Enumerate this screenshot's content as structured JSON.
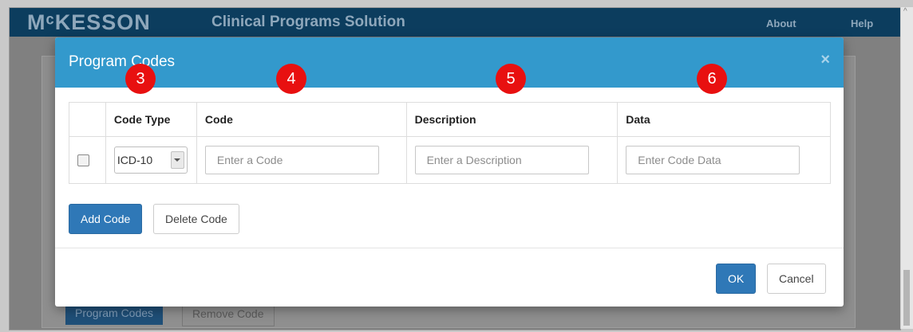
{
  "app": {
    "logo": "MᶜKESSON",
    "title": "Clinical Programs Solution",
    "nav": {
      "about": "About",
      "help": "Help"
    }
  },
  "background": {
    "program_codes_button": "Program Codes",
    "remove_code_button": "Remove Code"
  },
  "modal": {
    "title": "Program Codes",
    "close_glyph": "×",
    "callouts": [
      "3",
      "4",
      "5",
      "6"
    ],
    "table": {
      "headers": [
        "",
        "Code Type",
        "Code",
        "Description",
        "Data"
      ],
      "row": {
        "code_type": "ICD-10",
        "code_placeholder": "Enter a Code",
        "description_placeholder": "Enter a Description",
        "data_placeholder": "Enter Code Data"
      }
    },
    "add_code_button": "Add Code",
    "delete_code_button": "Delete Code",
    "ok_button": "OK",
    "cancel_button": "Cancel"
  },
  "colors": {
    "header_blue": "#3399cc",
    "navbar": "#0c3d5e",
    "primary_button": "#2f78b7",
    "callout_red": "#e81010"
  }
}
